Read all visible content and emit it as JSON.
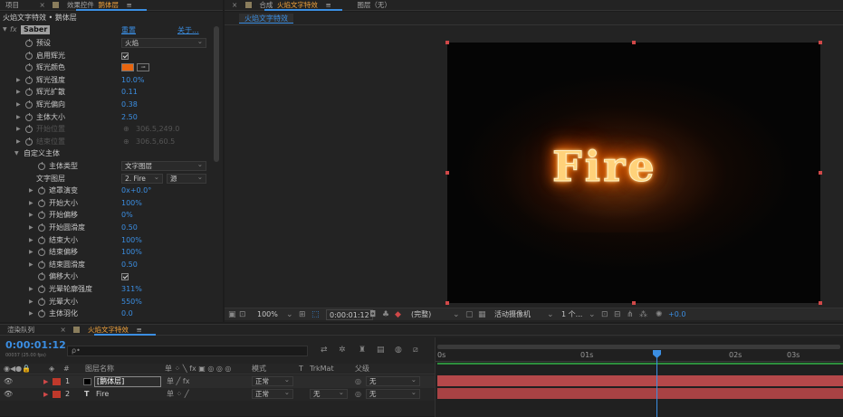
{
  "top_tabs": {
    "project": "项目",
    "effects_controls": "效果控件",
    "effects_layer": "鹅体层",
    "menu": "≡",
    "comp_label": "合成",
    "comp_name": "火焰文字特效",
    "layer_panel": "图层（无）"
  },
  "ec": {
    "breadcrumb": "火焰文字特效 • 鹅体层",
    "fx": "fx",
    "effect_name": "Saber",
    "reset": "重置",
    "about": "关于...",
    "rows": [
      {
        "label": "预设",
        "value": "火焰",
        "kind": "dropdown"
      },
      {
        "label": "启用辉光",
        "value": "",
        "kind": "check"
      },
      {
        "label": "辉光颜色",
        "value": "",
        "kind": "color"
      },
      {
        "label": "辉光强度",
        "value": "10.0%",
        "kind": "num"
      },
      {
        "label": "辉光扩散",
        "value": "0.11",
        "kind": "num"
      },
      {
        "label": "辉光偏向",
        "value": "0.38",
        "kind": "num"
      },
      {
        "label": "主体大小",
        "value": "2.50",
        "kind": "num"
      },
      {
        "label": "开始位置",
        "value": "306.5,249.0",
        "kind": "disabled"
      },
      {
        "label": "结束位置",
        "value": "306.5,60.5",
        "kind": "disabled"
      },
      {
        "label": "自定义主体",
        "value": "",
        "kind": "group"
      },
      {
        "label": "主体类型",
        "value": "文字图层",
        "kind": "dropdown"
      },
      {
        "label": "文字图层",
        "value": "2. Fire",
        "value2": "源",
        "kind": "dropdown2"
      },
      {
        "label": "遮罩演变",
        "value": "0x+0.0°",
        "kind": "num"
      },
      {
        "label": "开始大小",
        "value": "100%",
        "kind": "num"
      },
      {
        "label": "开始偏移",
        "value": "0%",
        "kind": "num"
      },
      {
        "label": "开始圆滑度",
        "value": "0.50",
        "kind": "num"
      },
      {
        "label": "结束大小",
        "value": "100%",
        "kind": "num"
      },
      {
        "label": "结束偏移",
        "value": "100%",
        "kind": "num"
      },
      {
        "label": "结束圆滑度",
        "value": "0.50",
        "kind": "num"
      },
      {
        "label": "偏移大小",
        "value": "",
        "kind": "check"
      },
      {
        "label": "光晕轮廓强度",
        "value": "311%",
        "kind": "num"
      },
      {
        "label": "光晕大小",
        "value": "550%",
        "kind": "num"
      },
      {
        "label": "主体羽化",
        "value": "0.0",
        "kind": "num"
      }
    ],
    "colors": {
      "glow": "#e8650f",
      "accent": "#3b8ee2"
    }
  },
  "viewer": {
    "subtab": "火焰文字特效",
    "fire_text": "Fire",
    "zoom": "100%",
    "timecode": "0:00:01:12",
    "quality": "(完整)",
    "camera": "活动摄像机",
    "views": "1 个...",
    "exposure": "+0.0"
  },
  "timeline": {
    "tab_render": "渲染队列",
    "tab_comp": "火焰文字特效",
    "timecode": "0:00:01:12",
    "sub_timecode": "00037 (25.00 fps)",
    "search_placeholder": "ρ•",
    "col_num": "#",
    "col_layername": "图层名称",
    "col_switches": "单 ⁘ ╲ fx ▣ ◎ ◎ ◎",
    "col_mode": "模式",
    "col_t": "T",
    "col_trkmat": "TrkMat",
    "col_parent": "父级",
    "ruler": [
      "0s",
      "01s",
      "02s",
      "03s"
    ],
    "layers": [
      {
        "num": "1",
        "name": "[鹅体层]",
        "mode": "正常",
        "trkmat": "",
        "parent": "无",
        "color": "#c0392b",
        "type": "solid"
      },
      {
        "num": "2",
        "name": "Fire",
        "mode": "正常",
        "trkmat": "无",
        "parent": "无",
        "color": "#c0392b",
        "type": "text"
      }
    ]
  }
}
